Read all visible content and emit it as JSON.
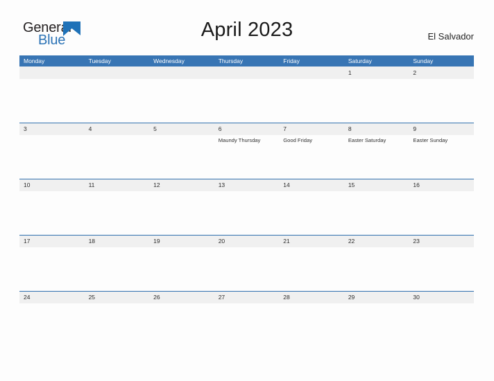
{
  "logo": {
    "word_one": "General",
    "word_two": "Blue",
    "icon": "blue-triangle-flag",
    "accent_color": "#2a72b5"
  },
  "header": {
    "title": "April 2023",
    "region": "El Salvador"
  },
  "colors": {
    "header_bar": "#3875b4",
    "date_band": "#f0f0f0",
    "row_rule": "#2f6fae",
    "page_background": "#fdfdfd"
  },
  "calendar": {
    "weekday_headers": [
      "Monday",
      "Tuesday",
      "Wednesday",
      "Thursday",
      "Friday",
      "Saturday",
      "Sunday"
    ],
    "weeks": [
      [
        {
          "day": "",
          "event": ""
        },
        {
          "day": "",
          "event": ""
        },
        {
          "day": "",
          "event": ""
        },
        {
          "day": "",
          "event": ""
        },
        {
          "day": "",
          "event": ""
        },
        {
          "day": "1",
          "event": ""
        },
        {
          "day": "2",
          "event": ""
        }
      ],
      [
        {
          "day": "3",
          "event": ""
        },
        {
          "day": "4",
          "event": ""
        },
        {
          "day": "5",
          "event": ""
        },
        {
          "day": "6",
          "event": "Maundy Thursday"
        },
        {
          "day": "7",
          "event": "Good Friday"
        },
        {
          "day": "8",
          "event": "Easter Saturday"
        },
        {
          "day": "9",
          "event": "Easter Sunday"
        }
      ],
      [
        {
          "day": "10",
          "event": ""
        },
        {
          "day": "11",
          "event": ""
        },
        {
          "day": "12",
          "event": ""
        },
        {
          "day": "13",
          "event": ""
        },
        {
          "day": "14",
          "event": ""
        },
        {
          "day": "15",
          "event": ""
        },
        {
          "day": "16",
          "event": ""
        }
      ],
      [
        {
          "day": "17",
          "event": ""
        },
        {
          "day": "18",
          "event": ""
        },
        {
          "day": "19",
          "event": ""
        },
        {
          "day": "20",
          "event": ""
        },
        {
          "day": "21",
          "event": ""
        },
        {
          "day": "22",
          "event": ""
        },
        {
          "day": "23",
          "event": ""
        }
      ],
      [
        {
          "day": "24",
          "event": ""
        },
        {
          "day": "25",
          "event": ""
        },
        {
          "day": "26",
          "event": ""
        },
        {
          "day": "27",
          "event": ""
        },
        {
          "day": "28",
          "event": ""
        },
        {
          "day": "29",
          "event": ""
        },
        {
          "day": "30",
          "event": ""
        }
      ]
    ]
  }
}
